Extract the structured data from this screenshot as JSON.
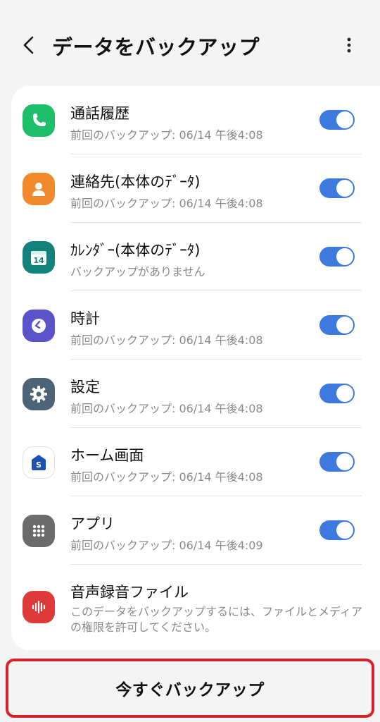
{
  "header": {
    "title": "データをバックアップ",
    "back_icon": "chevron-left-icon",
    "more_icon": "more-vertical-icon"
  },
  "items": [
    {
      "title": "通話履歴",
      "subtitle": "前回のバックアップ: 06/14 午後4:08",
      "icon": "phone-icon",
      "icon_color": "#1fbe6a",
      "enabled": true
    },
    {
      "title": "連絡先(本体のﾃﾞｰﾀ)",
      "subtitle": "前回のバックアップ: 06/14 午後4:08",
      "icon": "contact-icon",
      "icon_color": "#f08a2c",
      "enabled": true
    },
    {
      "title": "ｶﾚﾝﾀﾞｰ(本体のﾃﾞｰﾀ)",
      "subtitle": "バックアップがありません",
      "icon": "calendar-icon",
      "icon_color": "#12837a",
      "icon_text": "14",
      "enabled": true
    },
    {
      "title": "時計",
      "subtitle": "前回のバックアップ: 06/14 午後4:08",
      "icon": "clock-icon",
      "icon_color": "#5b53c9",
      "enabled": true
    },
    {
      "title": "設定",
      "subtitle": "前回のバックアップ: 06/14 午後4:08",
      "icon": "gear-icon",
      "icon_color": "#4d6478",
      "enabled": true
    },
    {
      "title": "ホーム画面",
      "subtitle": "前回のバックアップ: 06/14 午後4:08",
      "icon": "home-screen-icon",
      "icon_color": "#1e4fb5",
      "icon_text": "S",
      "enabled": true
    },
    {
      "title": "アプリ",
      "subtitle": "前回のバックアップ: 06/14 午後4:09",
      "icon": "apps-grid-icon",
      "icon_color": "#6b6b6b",
      "enabled": true
    },
    {
      "title": "音声録音ファイル",
      "subtitle": "このデータをバックアップするには、ファイルとメディアの権限を許可してください。",
      "icon": "voice-recorder-icon",
      "icon_color": "#de3a3a",
      "enabled": false
    }
  ],
  "bottom_button": {
    "label": "今すぐバックアップ"
  },
  "colors": {
    "accent": "#3e79e0",
    "highlight": "#d8232a"
  }
}
